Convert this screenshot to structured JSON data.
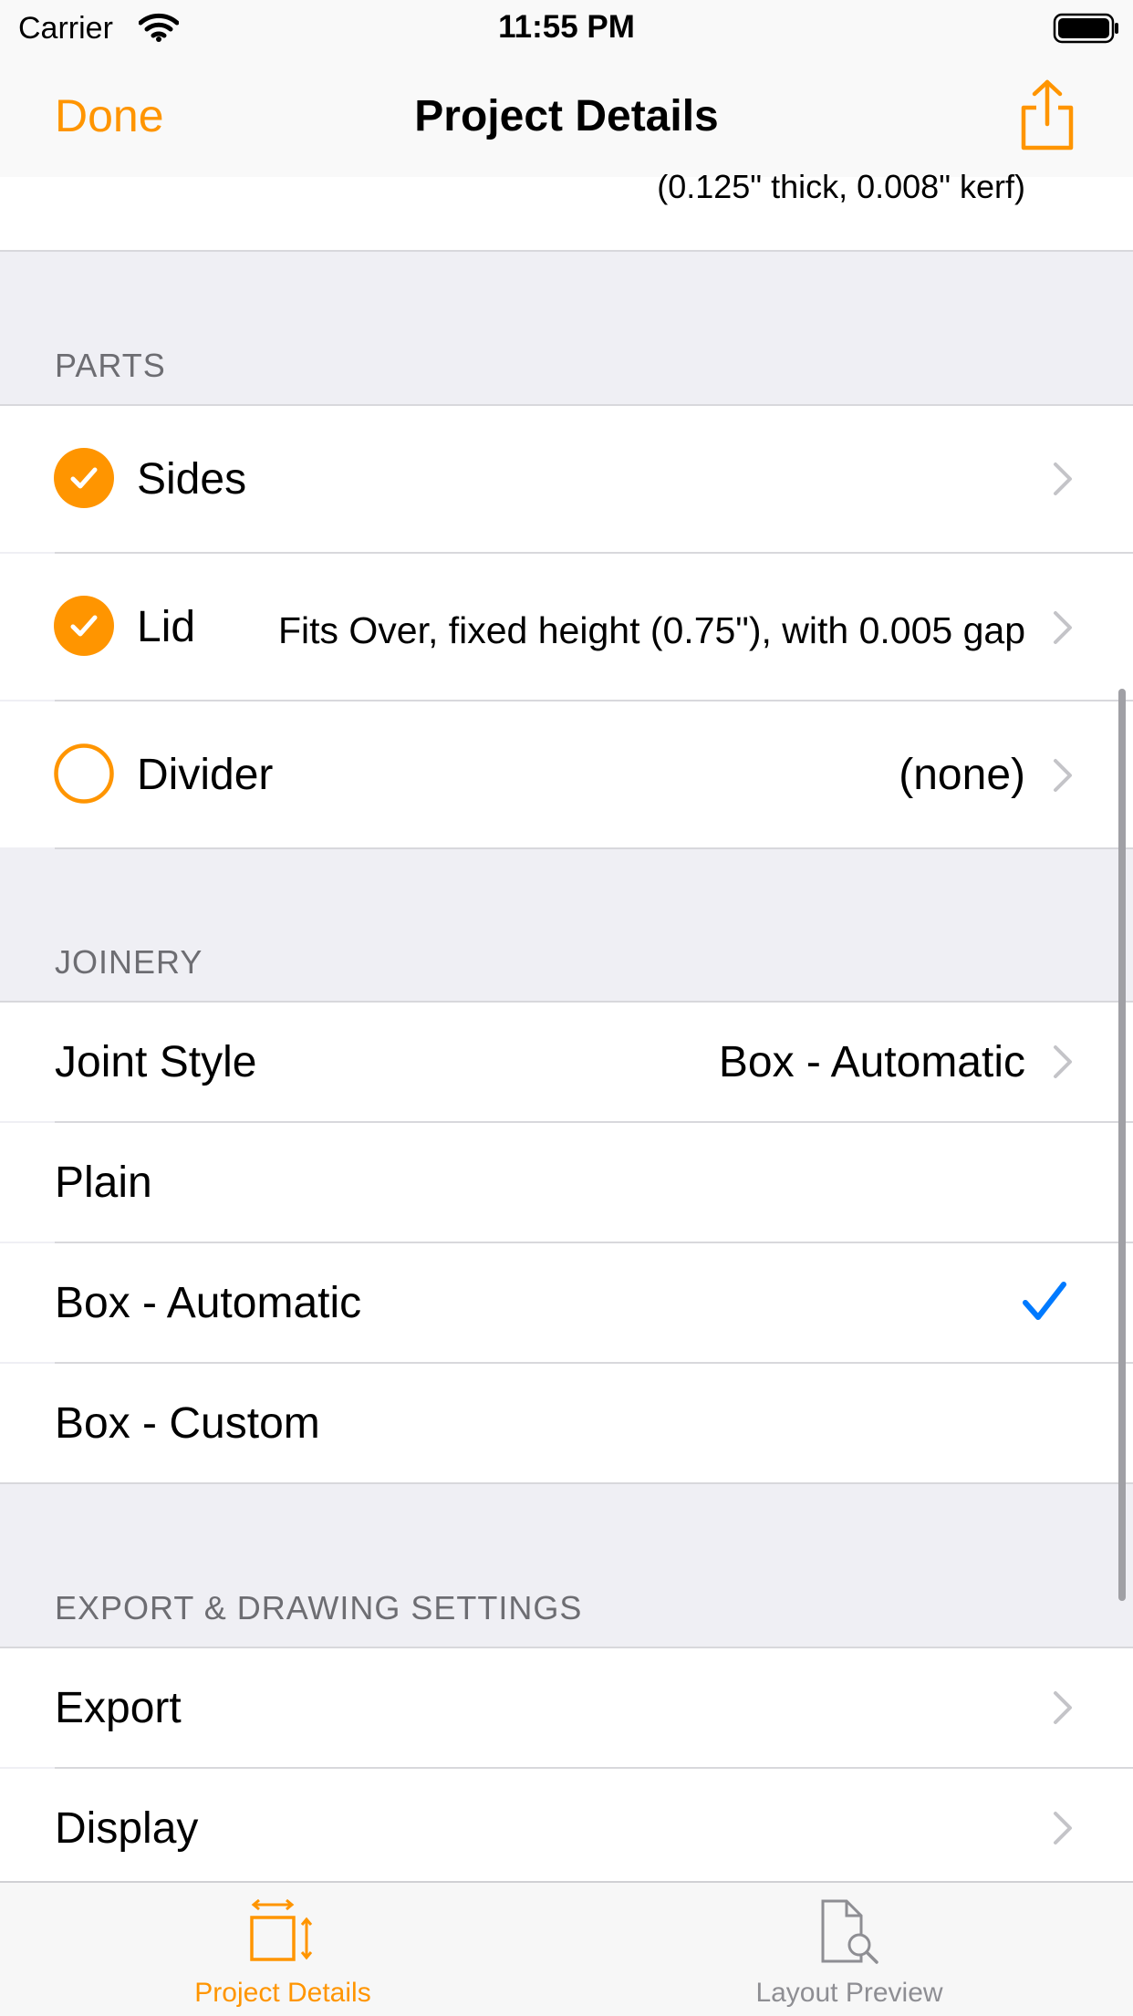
{
  "status_bar": {
    "carrier": "Carrier",
    "time": "11:55 PM"
  },
  "nav": {
    "done_label": "Done",
    "title": "Project Details"
  },
  "top_cell": {
    "value": "(0.125\" thick, 0.008\" kerf)"
  },
  "sections": {
    "parts": {
      "header": "PARTS",
      "rows": [
        {
          "label": "Sides",
          "value": "",
          "checked": true
        },
        {
          "label": "Lid",
          "value": "Fits Over, fixed height (0.75\"), with 0.005 gap",
          "checked": true
        },
        {
          "label": "Divider",
          "value": "(none)",
          "checked": false
        }
      ]
    },
    "joinery": {
      "header": "JOINERY",
      "joint_style": {
        "label": "Joint Style",
        "value": "Box - Automatic"
      },
      "options": [
        {
          "label": "Plain",
          "selected": false
        },
        {
          "label": "Box - Automatic",
          "selected": true
        },
        {
          "label": "Box - Custom",
          "selected": false
        }
      ]
    },
    "export": {
      "header": "EXPORT & DRAWING SETTINGS",
      "rows": [
        {
          "label": "Export"
        },
        {
          "label": "Display"
        }
      ]
    }
  },
  "tab_bar": {
    "tabs": [
      {
        "label": "Project Details",
        "icon": "resize-box-icon",
        "active": true
      },
      {
        "label": "Layout Preview",
        "icon": "document-search-icon",
        "active": false
      }
    ]
  },
  "colors": {
    "accent": "#ff9500",
    "checkmark": "#007aff",
    "inactive_tab": "#8e8e93"
  }
}
